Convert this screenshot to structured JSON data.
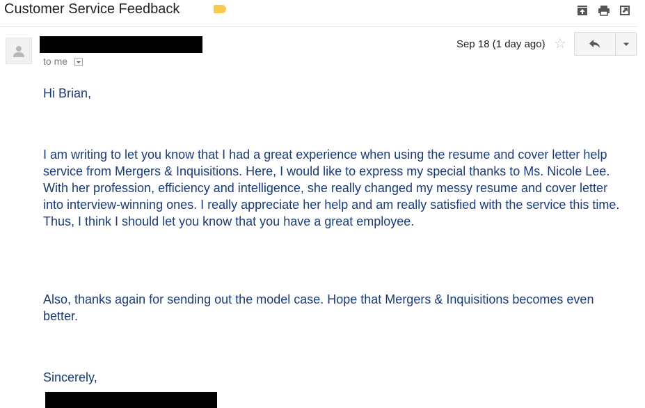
{
  "email": {
    "subject": "Customer Service Feedback",
    "recipient_label": "to me",
    "date": "Sep 18 (1 day ago)",
    "greeting": "Hi Brian,",
    "paragraphs": [
      "I am writing to let you know that I had a great experience when using the resume and cover letter help service from Mergers & Inquisitions. Here, I would like to express my special thanks to Ms. Nicole Lee. With her profession, efficiency and intelligence, she really changed my messy resume and cover letter into interview-winning ones. I really appreciate her help and am really satisfied with the service this time. Thus, I think I should let you know that you have a great employee.",
      "Also, thanks again for sending out the model case. Hope that Mergers & Inquisitions becomes even better."
    ],
    "closing": "Sincerely,"
  },
  "icons": {
    "label": "important-label-icon",
    "archive": "archive-icon",
    "print": "print-icon",
    "new_window": "open-in-new-window-icon",
    "avatar": "person-icon",
    "star": "star-icon",
    "reply": "reply-icon",
    "more": "dropdown-arrow-icon"
  },
  "colors": {
    "label": "#f7cb4d",
    "body_text": "#1a3a78",
    "meta_text": "#777777"
  }
}
